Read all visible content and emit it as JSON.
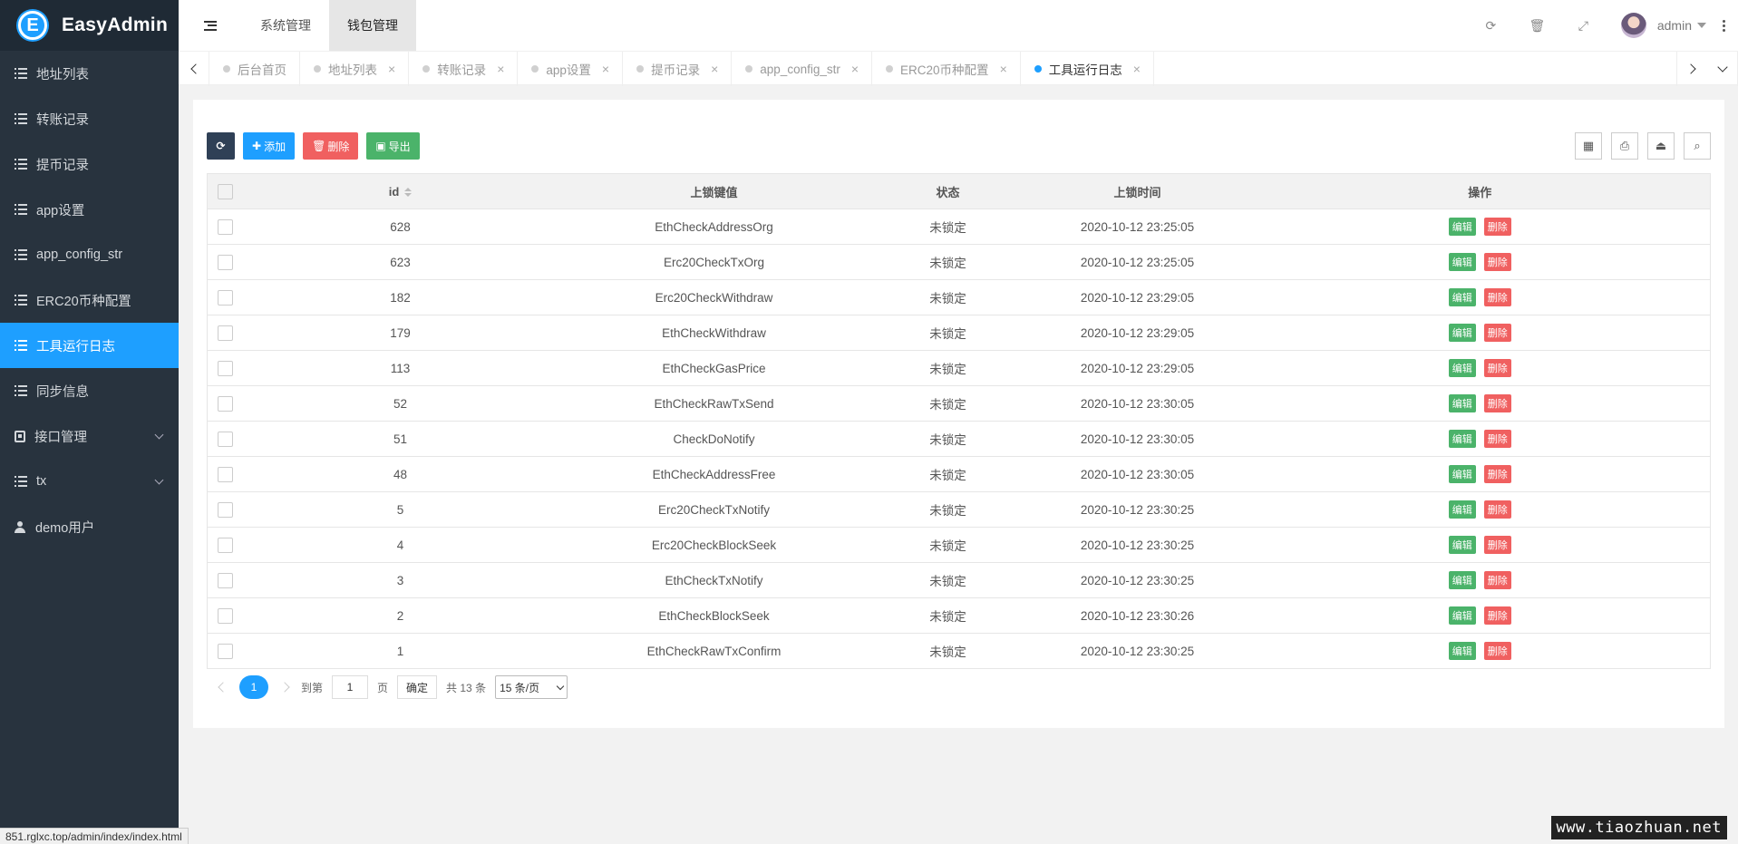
{
  "app": {
    "name": "EasyAdmin",
    "logo_letter": "E"
  },
  "sidebar": {
    "items": [
      {
        "label": "地址列表",
        "icon": "list-icon",
        "active": false
      },
      {
        "label": "转账记录",
        "icon": "list-icon",
        "active": false
      },
      {
        "label": "提币记录",
        "icon": "list-icon",
        "active": false
      },
      {
        "label": "app设置",
        "icon": "list-icon",
        "active": false
      },
      {
        "label": "app_config_str",
        "icon": "list-icon",
        "active": false
      },
      {
        "label": "ERC20币种配置",
        "icon": "list-icon",
        "active": false
      },
      {
        "label": "工具运行日志",
        "icon": "list-icon",
        "active": true
      },
      {
        "label": "同步信息",
        "icon": "list-icon",
        "active": false
      },
      {
        "label": "接口管理",
        "icon": "api-icon",
        "active": false,
        "expandable": true
      },
      {
        "label": "tx",
        "icon": "list-icon",
        "active": false,
        "expandable": true
      },
      {
        "label": "demo用户",
        "icon": "user-icon",
        "active": false
      }
    ]
  },
  "header": {
    "nav": [
      {
        "label": "系统管理",
        "active": false
      },
      {
        "label": "钱包管理",
        "active": true
      }
    ],
    "icons": [
      "refresh-icon",
      "trash-icon",
      "fullscreen-icon"
    ],
    "user": "admin"
  },
  "tabs": [
    {
      "label": "后台首页",
      "closable": false,
      "active": false
    },
    {
      "label": "地址列表",
      "closable": true,
      "active": false
    },
    {
      "label": "转账记录",
      "closable": true,
      "active": false
    },
    {
      "label": "app设置",
      "closable": true,
      "active": false
    },
    {
      "label": "提币记录",
      "closable": true,
      "active": false
    },
    {
      "label": "app_config_str",
      "closable": true,
      "active": false
    },
    {
      "label": "ERC20币种配置",
      "closable": true,
      "active": false
    },
    {
      "label": "工具运行日志",
      "closable": true,
      "active": true
    }
  ],
  "toolbar": {
    "refresh_icon": "⟳",
    "add_label": "添加",
    "delete_label": "删除",
    "export_label": "导出"
  },
  "table": {
    "columns": [
      "id",
      "上锁键值",
      "状态",
      "上锁时间",
      "操作"
    ],
    "edit_label": "编辑",
    "delete_label": "删除",
    "rows": [
      {
        "id": "628",
        "key": "EthCheckAddressOrg",
        "status": "未锁定",
        "time": "2020-10-12 23:25:05"
      },
      {
        "id": "623",
        "key": "Erc20CheckTxOrg",
        "status": "未锁定",
        "time": "2020-10-12 23:25:05"
      },
      {
        "id": "182",
        "key": "Erc20CheckWithdraw",
        "status": "未锁定",
        "time": "2020-10-12 23:29:05"
      },
      {
        "id": "179",
        "key": "EthCheckWithdraw",
        "status": "未锁定",
        "time": "2020-10-12 23:29:05"
      },
      {
        "id": "113",
        "key": "EthCheckGasPrice",
        "status": "未锁定",
        "time": "2020-10-12 23:29:05"
      },
      {
        "id": "52",
        "key": "EthCheckRawTxSend",
        "status": "未锁定",
        "time": "2020-10-12 23:30:05"
      },
      {
        "id": "51",
        "key": "CheckDoNotify",
        "status": "未锁定",
        "time": "2020-10-12 23:30:05"
      },
      {
        "id": "48",
        "key": "EthCheckAddressFree",
        "status": "未锁定",
        "time": "2020-10-12 23:30:05"
      },
      {
        "id": "5",
        "key": "Erc20CheckTxNotify",
        "status": "未锁定",
        "time": "2020-10-12 23:30:25"
      },
      {
        "id": "4",
        "key": "Erc20CheckBlockSeek",
        "status": "未锁定",
        "time": "2020-10-12 23:30:25"
      },
      {
        "id": "3",
        "key": "EthCheckTxNotify",
        "status": "未锁定",
        "time": "2020-10-12 23:30:25"
      },
      {
        "id": "2",
        "key": "EthCheckBlockSeek",
        "status": "未锁定",
        "time": "2020-10-12 23:30:26"
      },
      {
        "id": "1",
        "key": "EthCheckRawTxConfirm",
        "status": "未锁定",
        "time": "2020-10-12 23:30:25"
      }
    ]
  },
  "pager": {
    "current": "1",
    "goto_label": "到第",
    "goto_value": "1",
    "page_label": "页",
    "confirm_label": "确定",
    "total_label": "共 13 条",
    "page_size": "15 条/页"
  },
  "statusbar": {
    "url": "851.rglxc.top/admin/index/index.html"
  },
  "watermark": "www.tiaozhuan.net"
}
